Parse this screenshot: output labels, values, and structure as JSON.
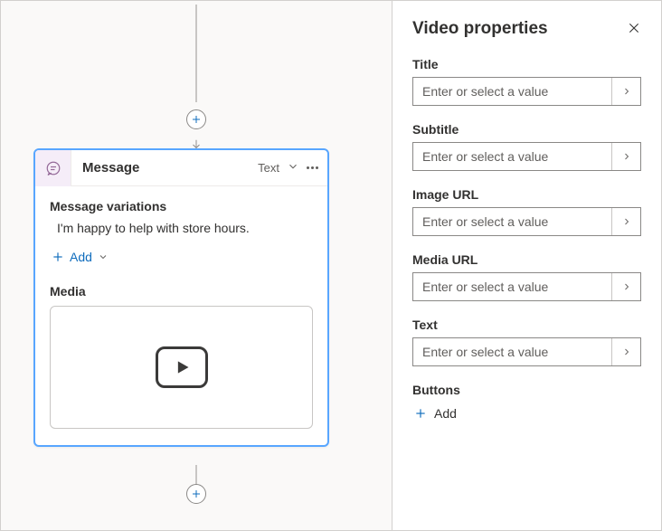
{
  "canvas": {
    "node": {
      "title": "Message",
      "type_label": "Text",
      "variations_label": "Message variations",
      "variation_text": "I'm happy to help with store hours.",
      "add_label": "Add",
      "media_label": "Media"
    }
  },
  "panel": {
    "title": "Video properties",
    "placeholder": "Enter or select a value",
    "fields": {
      "title": "Title",
      "subtitle": "Subtitle",
      "image_url": "Image URL",
      "media_url": "Media URL",
      "text": "Text",
      "buttons": "Buttons"
    },
    "add_label": "Add"
  }
}
